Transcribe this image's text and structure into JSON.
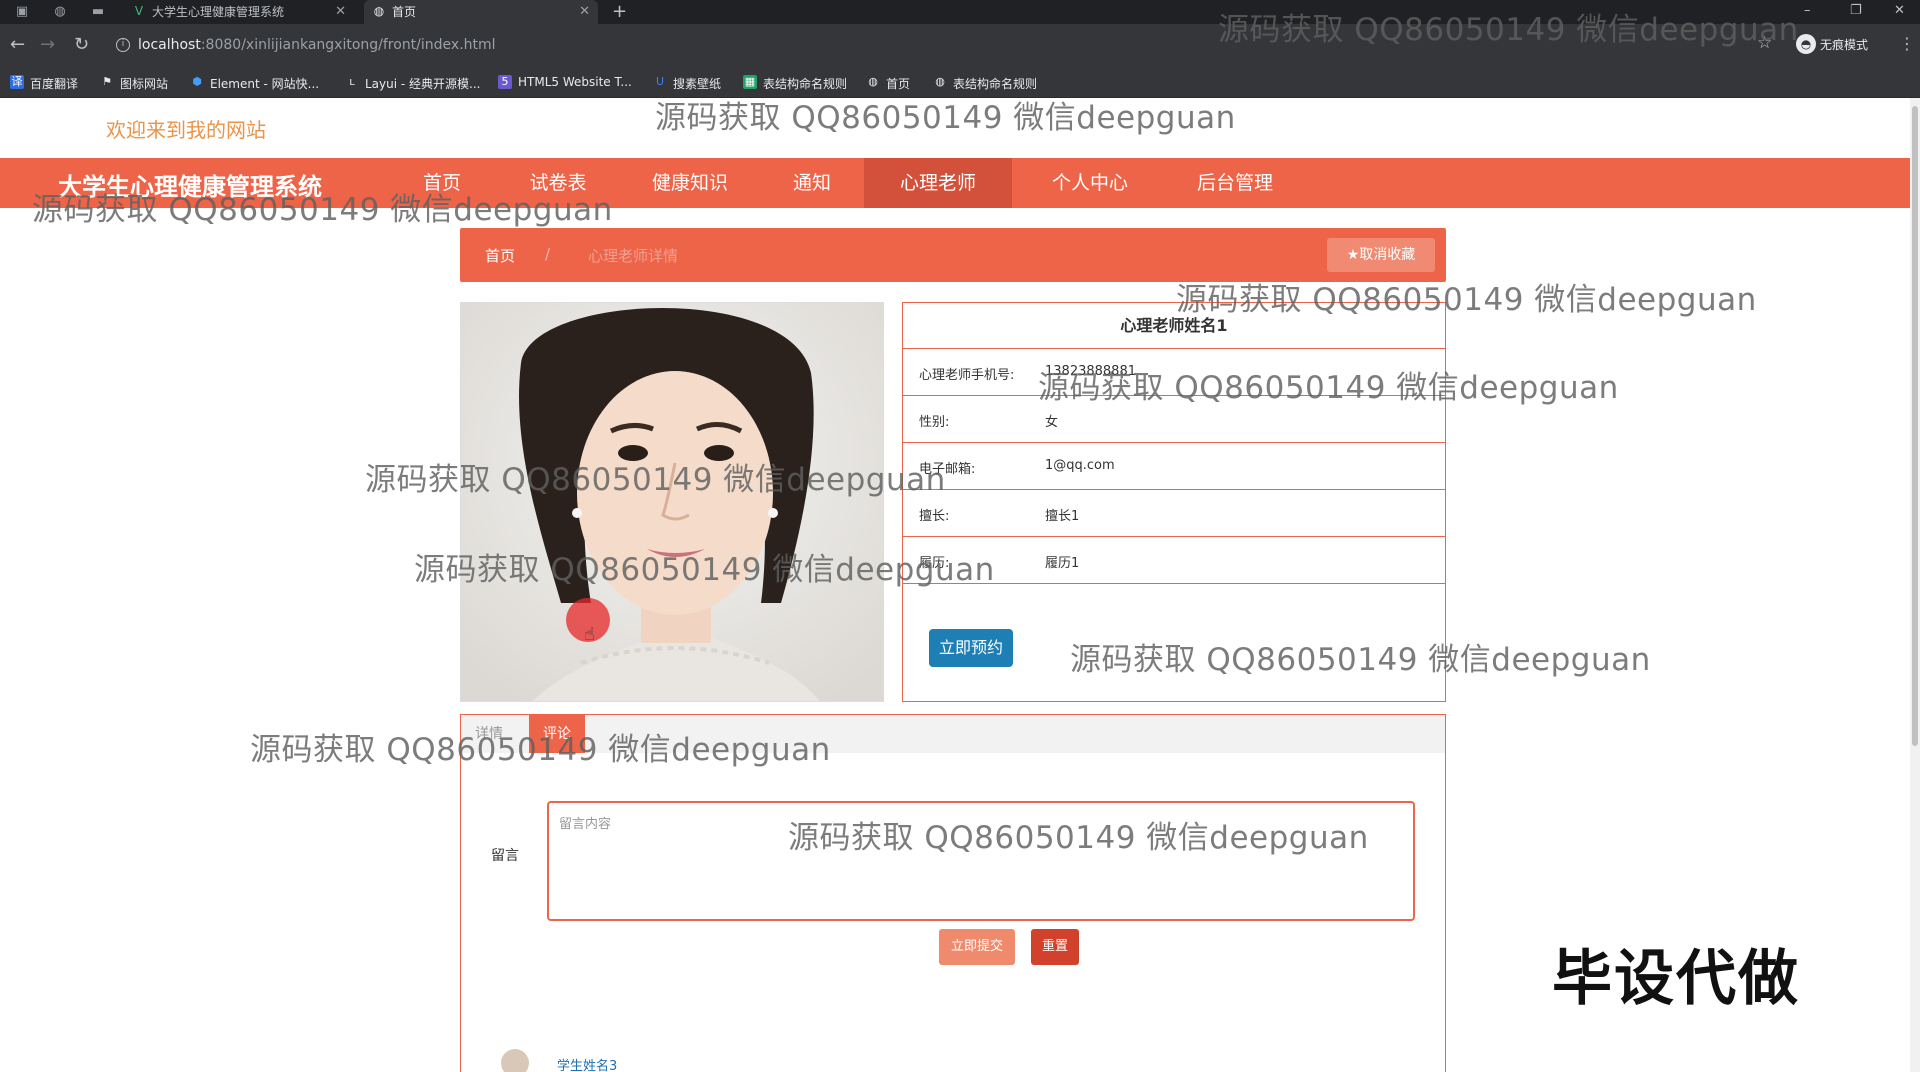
{
  "browser": {
    "tabs": [
      {
        "title": "大学生心理健康管理系统",
        "favicon": "vue-icon"
      },
      {
        "title": "首页",
        "favicon": "globe-icon"
      }
    ],
    "new_tab": "+",
    "url_host": "localhost",
    "url_path": ":8080/xinlijiankangxitong/front/index.html",
    "incognito_label": "无痕模式",
    "bookmarks": [
      {
        "label": "百度翻译",
        "icon": "translate-icon",
        "color": "#2f6fe4"
      },
      {
        "label": "图标网站",
        "icon": "flag-icon",
        "color": "#e8eaed"
      },
      {
        "label": "Element - 网站快...",
        "icon": "element-icon",
        "color": "#409eff"
      },
      {
        "label": "Layui - 经典开源模...",
        "icon": "layui-icon",
        "color": "#e8eaed"
      },
      {
        "label": "HTML5 Website T...",
        "icon": "html5-icon",
        "color": "#6a5acd"
      },
      {
        "label": "搜素壁纸",
        "icon": "wallpaper-icon",
        "color": "#3b82f6"
      },
      {
        "label": "表结构命名规则",
        "icon": "sheet-icon",
        "color": "#1fa463"
      },
      {
        "label": "首页",
        "icon": "globe-icon",
        "color": "#e8eaed"
      },
      {
        "label": "表结构命名规则",
        "icon": "globe-icon",
        "color": "#e8eaed"
      }
    ]
  },
  "header": {
    "welcome": "欢迎来到我的网站"
  },
  "nav": {
    "site_title": "大学生心理健康管理系统",
    "items": [
      "首页",
      "试卷表",
      "健康知识",
      "通知",
      "心理老师",
      "个人中心",
      "后台管理"
    ],
    "active_index": 4
  },
  "breadcrumb": {
    "home": "首页",
    "separator": "/",
    "current": "心理老师详情",
    "favorite_button": "★取消收藏"
  },
  "teacher": {
    "name": "心理老师姓名1",
    "fields": [
      {
        "label": "心理老师手机号:",
        "value": "13823888881"
      },
      {
        "label": "性别:",
        "value": "女"
      },
      {
        "label": "电子邮箱:",
        "value": "1@qq.com"
      },
      {
        "label": "擅长:",
        "value": "擅长1"
      },
      {
        "label": "履历:",
        "value": "履历1"
      }
    ],
    "book_button": "立即预约"
  },
  "comments": {
    "tabs": [
      "详情",
      "评论"
    ],
    "message_label": "留言",
    "message_placeholder": "留言内容",
    "submit_button": "立即提交",
    "reset_button": "重置",
    "first_comment_user": "学生姓名3"
  },
  "watermarks": [
    "源码获取 QQ86050149 微信deepguan",
    "源码获取 QQ86050149 微信deepguan",
    "源码获取 QQ86050149 微信deepguan",
    "源码获取 QQ86050149 微信deepguan",
    "源码获取 QQ86050149 微信deepguan",
    "源码获取 QQ86050149 微信deepguan",
    "源码获取 QQ86050149 微信deepguan",
    "源码获取 QQ86050149 微信deepguan",
    "源码获取 QQ86050149 微信deepguan",
    "源码获取 QQ86050149 微信deepguan"
  ],
  "stamp": "毕设代做",
  "colors": {
    "brand": "#ee6449",
    "brand_active": "#d3503a",
    "primary_button": "#1e7fb5",
    "welcome_text": "#e8944a"
  }
}
